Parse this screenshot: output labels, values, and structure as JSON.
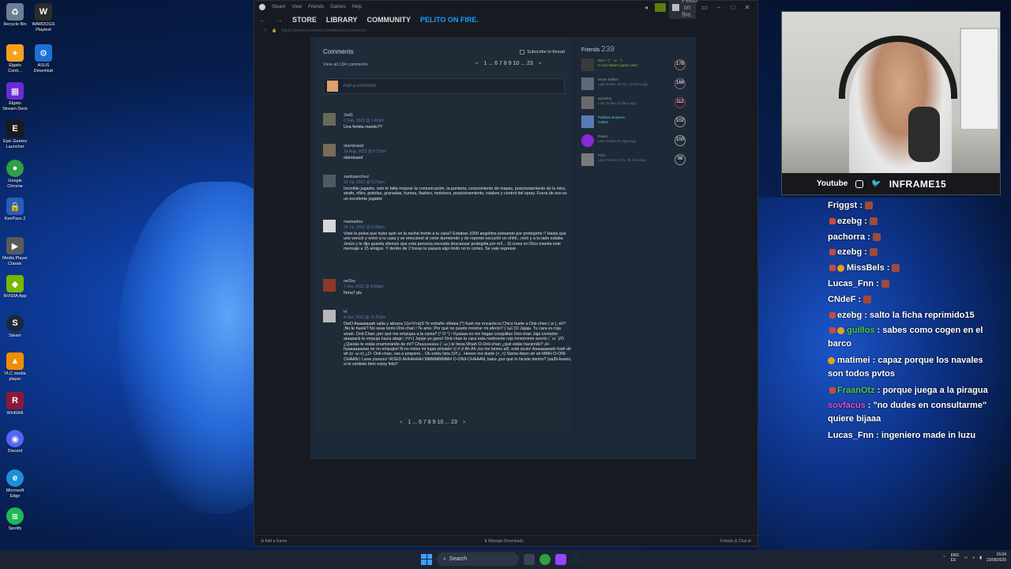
{
  "desktop": {
    "icons": [
      {
        "label": "Recycle Bin",
        "color": "#6c7f93",
        "glyph": "♻"
      },
      {
        "label": "WARDOGS Playtest",
        "color": "#2b2b2b",
        "glyph": "W"
      },
      {
        "label": "Elgato Contr...",
        "color": "#f4a21c",
        "glyph": "✦"
      },
      {
        "label": "ASUS DriverHub",
        "color": "#1f6fd6",
        "glyph": "⚙"
      },
      {
        "label": "Elgato Stream Deck",
        "color": "#6a2bd6",
        "glyph": "▦"
      },
      {
        "label": "Epic Games Launcher",
        "color": "#1a1a1a",
        "glyph": "E"
      },
      {
        "label": "Google Chrome",
        "color": "#2f9e44",
        "glyph": "●"
      },
      {
        "label": "KeePass 2",
        "color": "#2b5db8",
        "glyph": "🔒"
      },
      {
        "label": "Media Player Classic",
        "color": "#5a5a5a",
        "glyph": "▶"
      },
      {
        "label": "NVIDIA App",
        "color": "#76b900",
        "glyph": "◆"
      },
      {
        "label": "Steam",
        "color": "#1b2838",
        "glyph": "S"
      },
      {
        "label": "VLC media player",
        "color": "#f28c00",
        "glyph": "▲"
      },
      {
        "label": "WinRAR",
        "color": "#8b1a3a",
        "glyph": "R"
      },
      {
        "label": "Discord",
        "color": "#5865f2",
        "glyph": "◉"
      },
      {
        "label": "Microsoft Edge",
        "color": "#1d8fd6",
        "glyph": "e"
      },
      {
        "label": "Spotify",
        "color": "#1db954",
        "glyph": "≋"
      }
    ]
  },
  "steam": {
    "titlebar_menu": [
      "Steam",
      "View",
      "Friends",
      "Games",
      "Help"
    ],
    "user_chip": "Pelito on fire.",
    "nav": {
      "store": "STORE",
      "library": "LIBRARY",
      "community": "COMMUNITY",
      "profile": "PELITO ON FIRE."
    },
    "url": "https://steamcommunity.com/id/xxxxx/comments",
    "comments": {
      "heading": "Comments",
      "view_all": "View all 134 comments",
      "subscribe": "Subscribe to thread",
      "pager_top": "1 ... 6 7 8 9 10 ... 23",
      "pager_bottom": "1 ... 6 7 8 9 10 ... 23",
      "add_placeholder": "Add a comment",
      "items": [
        {
          "author": "Jud1",
          "date": "6 Sep, 2022 @ 1:42am",
          "body": "Una firmita manito??",
          "avatar_color": "#6a6a5a"
        },
        {
          "author": "olaminaxd",
          "date": "18 Aug, 2022 @ 6:37pm",
          "body": "olaminaxd",
          "avatar_color": "#7a6a5a"
        },
        {
          "author": "santisanchez",
          "date": "30 Jul, 2022 @ 5:37pm",
          "body": "Increible jugador, solo le falta mejorar la comunicación, la punteria, conocimiento de mapas, posicionamiento de la mira, strafe, rifles, pistolas, granadas, humos, flashes, molotovs, posicionamiento, retakes y control del spray. Fuera de eso es un excelente jugador",
          "avatar_color": "#4e5a66"
        },
        {
          "author": "mamadou",
          "date": "28 Jul, 2022 @ 6:28pm",
          "body": "Viste la pelea que hubo ayer en la noche frente a tu casa? Estaban 1000 angelitos peleando por protegerte !! Hasta que uno venció y entró a tu casa y se emocionó al verte durmiendo y de repente escuchó un shhh...miró y a tu lado estaba Jesús y le dijo guarda silencio que esta persona necesita descansar protegida por mí!... Si crees en Dios manda este mensaje a 15 amigos. Y dentro de 2 horas te pasará algo lindo no lo cortes. Se vale regresar.",
          "avatar_color": "#d8d8d8"
        },
        {
          "author": "ne1by",
          "date": "7 Jun, 2022 @ 8:03pm",
          "body": "firma? pls",
          "avatar_color": "#8c3a2a"
        },
        {
          "author": "H",
          "date": "4 Jun, 2022 @ 11:57pm",
          "body": "OwO Aaaaaaaah salta y abraza 1(o>V<a)S Te extrañe olfatea (^) fuah me encanta tu Chico huele a Onii-chan ( w ), eh? ;No te huele? No seas tonto Onii-chan ! Te amo ;Por qué no puedo mostrar mi afecto? (`/ω\\´)O Jajaja. Tu cara es roja woah. Onii-Chan ¡por qué me empujas a la cama? (° O °) / Kyaaaa no me hagas cosquillas Onii-chan Jaja contador ataaaack te empuja hacia abajo ;>V<) Jejeje yo gano! Onii-chan tu cara esta realmente roja hmmmmm sonríe ( `ω´ )/O ¿Quizás te estás enamorando de mí? Chuuuuuuuu (`-ω-) te besa Woah O-Onii-chan ¿qué estás haciendo? ¡H- hyaaaaaaaaa no no empujes! N-no mires mi lugar privado! (/-//-)/ Ah Ah ¡no me lames allí, está sucio! Aaaaaaaaah fuah ah ah (o ·ω·o) ¿O- Onii-chan, vas a propone... Ok estoy lista (V/\\.) . Heeee me duele (>_<) Swow dwon ah ah MMH O-ONI-CHAAN I Lwve yoooou! IRSED AHHHHHH MMMMMMMH O-ONII-CHAAAN, baka ¡por qué lo hiciste dentro? (oa3li-bueno, si te sentiste bien estoy feliz!!",
          "avatar_color": "#b8b8b8"
        }
      ]
    },
    "friends": {
      "title": "Friends",
      "count": "239",
      "rows": [
        {
          "name": "Erni ~ (˘ · ω · ˘)",
          "status": "In non-Steam game UwU",
          "level": "178",
          "color": "#3a3a3a",
          "lvl_color": "#b06a3a"
        },
        {
          "name": "Snow Wilkes",
          "status": "Last Online 15 hrs, 43 mins ago",
          "level": "166",
          "color": "#5a6a7a",
          "lvl_color": "#8a5aa0"
        },
        {
          "name": "apolofep",
          "status": "Last Online 13 days ago",
          "level": "112",
          "color": "#6a6a6a",
          "lvl_color": "#a03a3a"
        },
        {
          "name": "Pablitas Suarees",
          "status": "Online",
          "level": "102",
          "color": "#5a7ab8",
          "lvl_color": "#8a8a8a"
        },
        {
          "name": "Rakaz",
          "status": "Last Online 26 days ago",
          "level": "100",
          "color": "#8a2ad6",
          "lvl_color": "#8a8a8a"
        },
        {
          "name": "PrSL",
          "status": "Last Online 2 hrs, 49 mins ago",
          "level": "98",
          "color": "#7a7a7a",
          "lvl_color": "#8a8a8a"
        }
      ]
    },
    "bottom": {
      "add_game": "Add a Game",
      "manage_downloads": "Manage Downloads",
      "friends_chat": "Friends & Chat"
    }
  },
  "webcam": {
    "youtube": "Youtube",
    "handle": "INFRAME15"
  },
  "chat": [
    {
      "user": "Friggst",
      "text": "",
      "color": "#ffffff"
    },
    {
      "user": "ezebg",
      "text": "",
      "color": "#ffffff"
    },
    {
      "user": "pachorra",
      "text": "",
      "color": "#ffffff"
    },
    {
      "user": "ezebg",
      "text": "",
      "color": "#ffffff"
    },
    {
      "user": "MissBels",
      "text": "",
      "color": "#ffffff"
    },
    {
      "user": "Lucas_Fnn",
      "text": "",
      "color": "#ffffff"
    },
    {
      "user": "CNdeF",
      "text": "",
      "color": "#ffffff"
    },
    {
      "user": "ezebg",
      "text": "salto la ficha reprimido15",
      "color": "#ffffff"
    },
    {
      "user": "guillos",
      "text": "sabes como cogen en el barco",
      "color": "#4ec94e"
    },
    {
      "user": "matimei",
      "text": "capaz porque los navales son todos pvtos",
      "color": "#ffffff"
    },
    {
      "user": "FraanOtz",
      "text": "porque juega a la piragua",
      "color": "#4ec94e"
    },
    {
      "user": "sovfacus",
      "text": "\"no dudes en consultarme\" quiere bijaaa",
      "color": "#e04be0"
    },
    {
      "user": "Lucas_Fnn",
      "text": "ingeniero made in luzu",
      "color": "#ffffff"
    }
  ],
  "taskbar": {
    "search": "Search",
    "lang": "ENG",
    "region": "ES",
    "time": "15:04",
    "date": "23/08/2026"
  }
}
